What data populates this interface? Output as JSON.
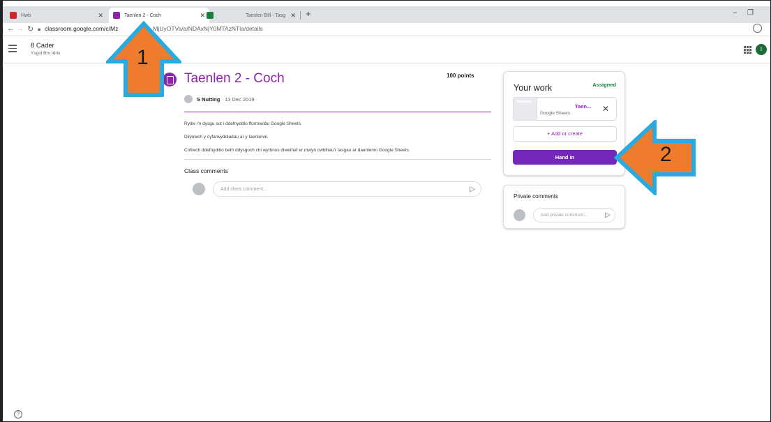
{
  "browser": {
    "tabs": [
      {
        "label": "Hwb",
        "icon": "hwb-icon",
        "color": "#cc2a2a"
      },
      {
        "label": "Taenlen 2 - Coch",
        "icon": "classroom-icon",
        "color": "#8e24aa"
      },
      {
        "label": "",
        "icon": "sheets-icon",
        "color": "#188038"
      },
      {
        "label": "Taenlen BIll - Tasg",
        "icon": "",
        "color": ""
      }
    ],
    "url_host": "classroom.google.com/c/Mz",
    "url_rest": "MjUyOTVa/a/NDAxNjY0MTAzNTla/details"
  },
  "header": {
    "class_name": "8 Cader",
    "school": "Ysgol Bro Idris",
    "avatar_letter": "I"
  },
  "assignment": {
    "title": "Taenlen 2 - Coch",
    "points": "100 points",
    "author": "S Nutting",
    "date": "13 Dec 2019",
    "description": [
      "Rydw i'n dysgu sut i ddefnyddio fformiwlâu Google Sheets.",
      "Dilynwch y cyfarwyddiadau ar y taenlenni.",
      "Cofiwch ddefnyddio beth ddysgoch chi wythnos diwethaf er mwyn cwblhau'r tasgau ar daenlenni Google Sheets."
    ],
    "class_comments_title": "Class comments",
    "class_comment_placeholder": "Add class comment..."
  },
  "your_work": {
    "title": "Your work",
    "status": "Assigned",
    "attachment_name": "Taen...",
    "attachment_type": "Google Sheets",
    "add_label": "+  Add or create",
    "hand_in_label": "Hand in"
  },
  "private_comments": {
    "title": "Private comments",
    "placeholder": "Add private comment..."
  },
  "annotations": {
    "arrow1_number": "1",
    "arrow2_number": "2",
    "arrow_fill": "#ef7c2d",
    "arrow_outline": "#29aae1"
  },
  "colors": {
    "accent": "#8e24aa",
    "hand_in": "#7627bb",
    "assigned": "#188038"
  }
}
